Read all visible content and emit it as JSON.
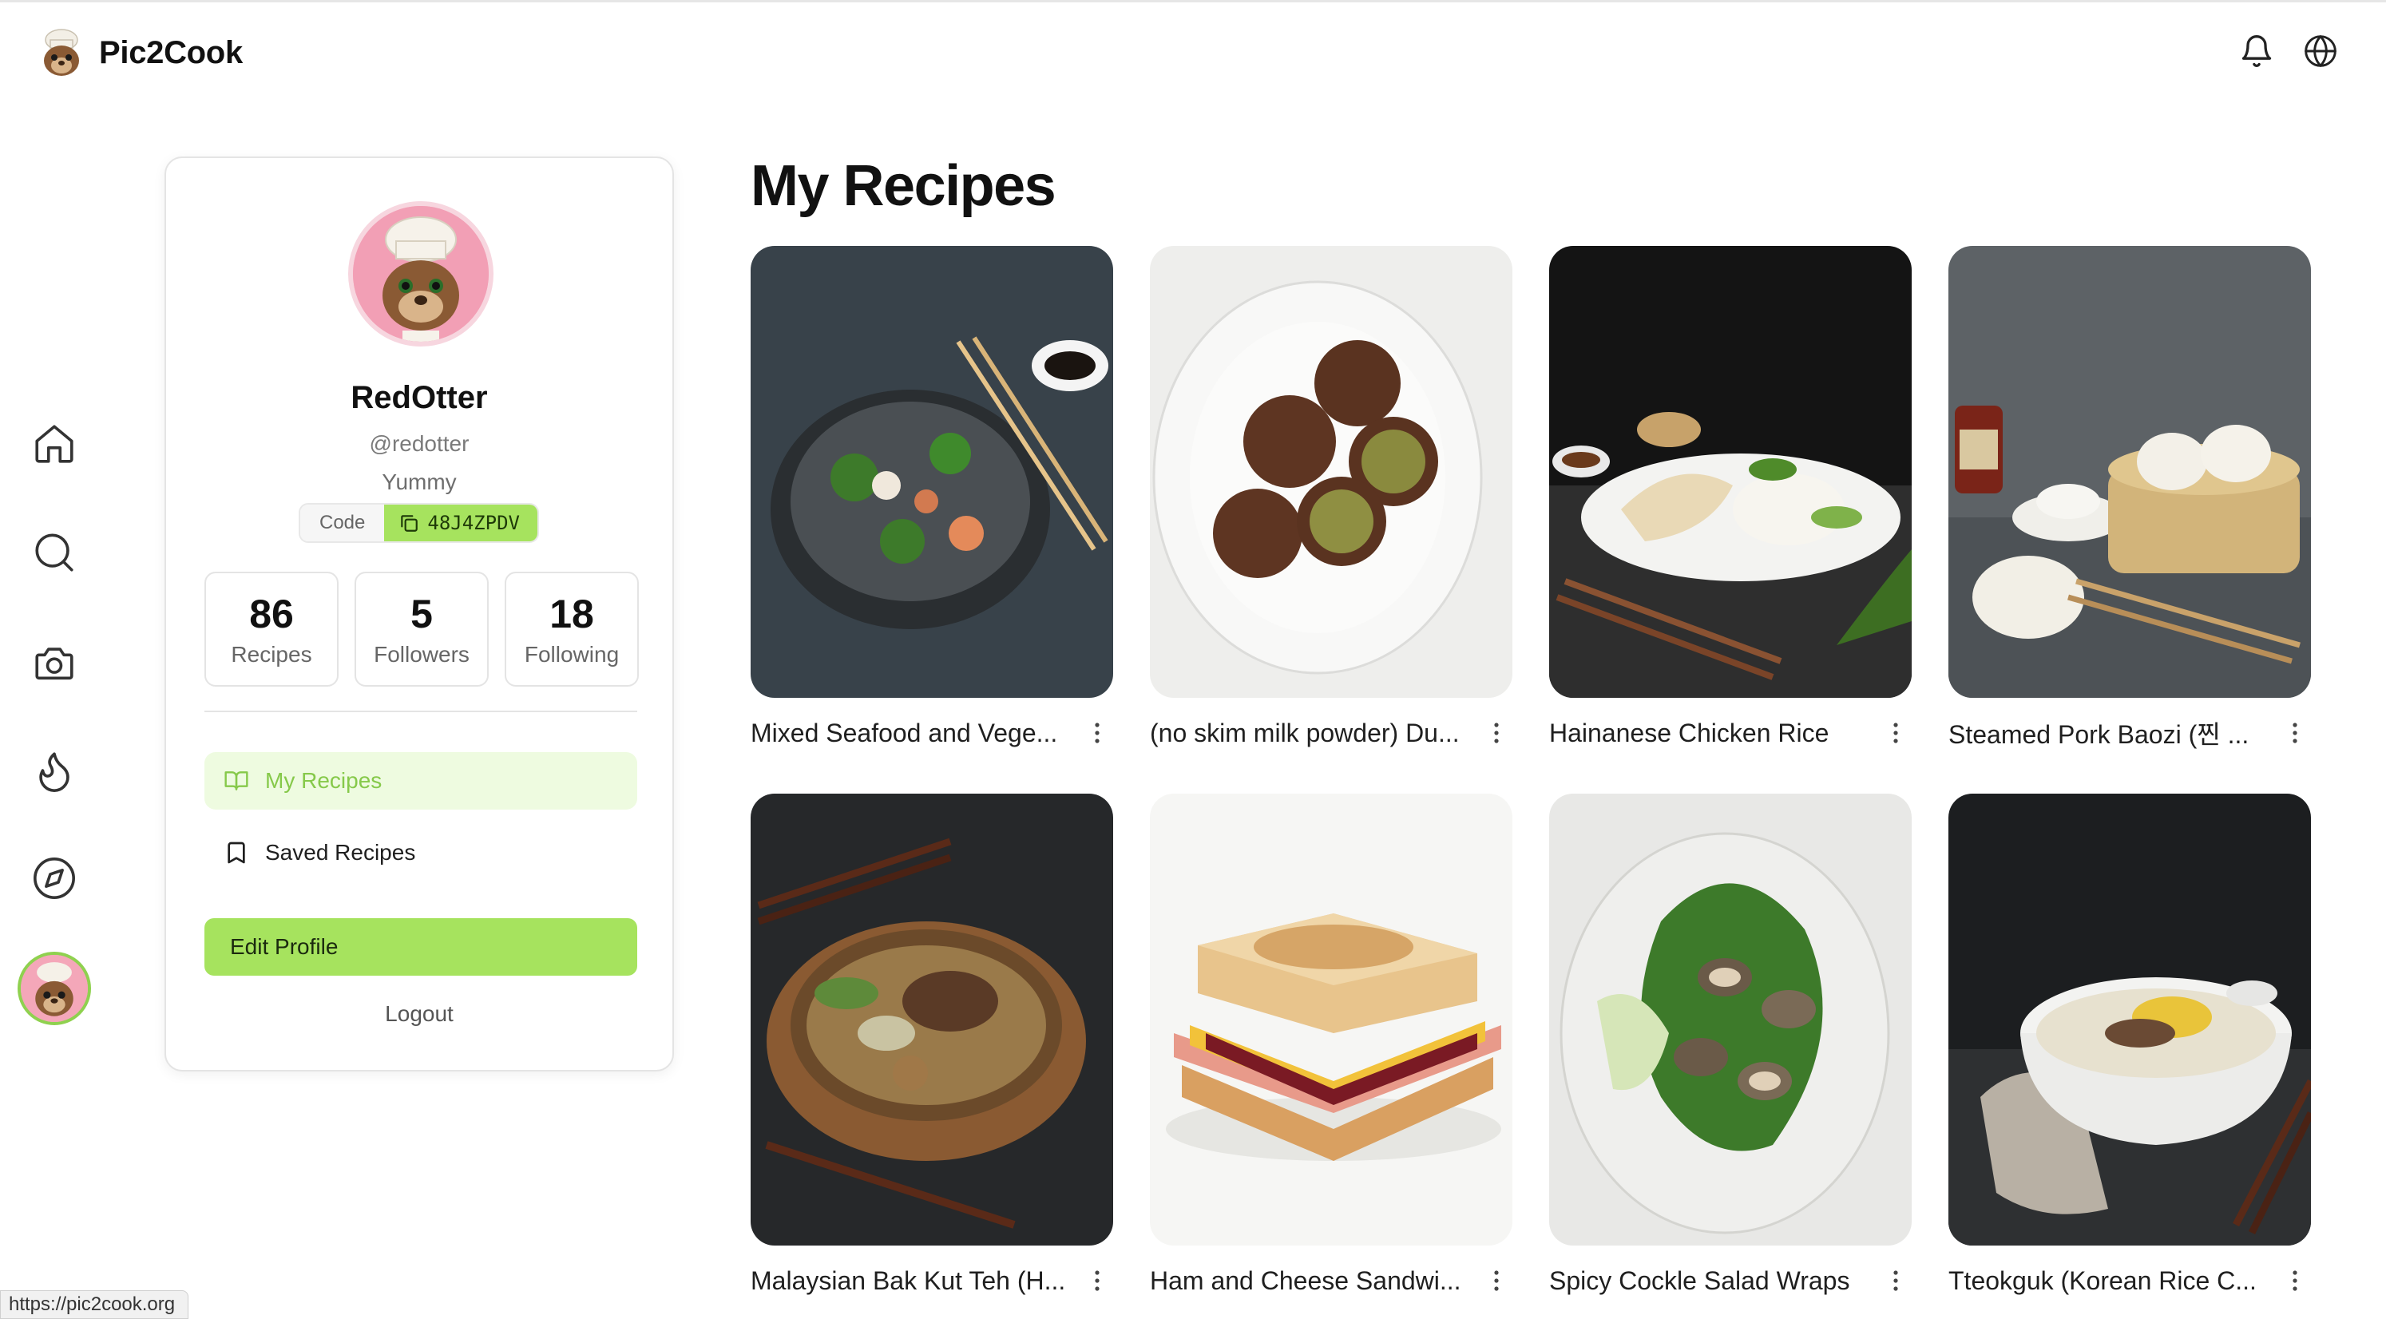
{
  "header": {
    "brand": "Pic2Cook",
    "icons": [
      "bell-icon",
      "globe-icon"
    ]
  },
  "nav": {
    "items": [
      "home-icon",
      "search-icon",
      "camera-icon",
      "flame-icon",
      "compass-icon",
      "profile-avatar"
    ]
  },
  "profile": {
    "display_name": "RedOtter",
    "handle": "@redotter",
    "bio": "Yummy",
    "code_label": "Code",
    "code_value": "48J4ZPDV",
    "stats": [
      {
        "value": "86",
        "label": "Recipes"
      },
      {
        "value": "5",
        "label": "Followers"
      },
      {
        "value": "18",
        "label": "Following"
      }
    ],
    "menu": {
      "my_recipes": "My Recipes",
      "saved_recipes": "Saved Recipes"
    },
    "edit_label": "Edit Profile",
    "logout_label": "Logout"
  },
  "main": {
    "title": "My Recipes",
    "recipes": [
      {
        "title": "Mixed Seafood and Vege...",
        "image": "seafood-vegetable-stirfry"
      },
      {
        "title": "(no skim milk powder) Du...",
        "image": "chocolate-matcha-balls"
      },
      {
        "title": "Hainanese Chicken Rice",
        "image": "chicken-rice"
      },
      {
        "title": "Steamed Pork Baozi (찐 ...",
        "image": "steamed-baozi"
      },
      {
        "title": "Malaysian Bak Kut Teh (H...",
        "image": "bak-kut-teh"
      },
      {
        "title": "Ham and Cheese Sandwi...",
        "image": "ham-cheese-sandwich"
      },
      {
        "title": "Spicy Cockle Salad Wraps",
        "image": "cockle-salad-wraps"
      },
      {
        "title": "Tteokguk (Korean Rice C...",
        "image": "tteokguk"
      }
    ]
  },
  "status_bar": {
    "url": "https://pic2cook.org"
  },
  "colors": {
    "accent": "#a6e35e",
    "accent_text": "#86c94a",
    "active_bg": "#eefbe0"
  }
}
